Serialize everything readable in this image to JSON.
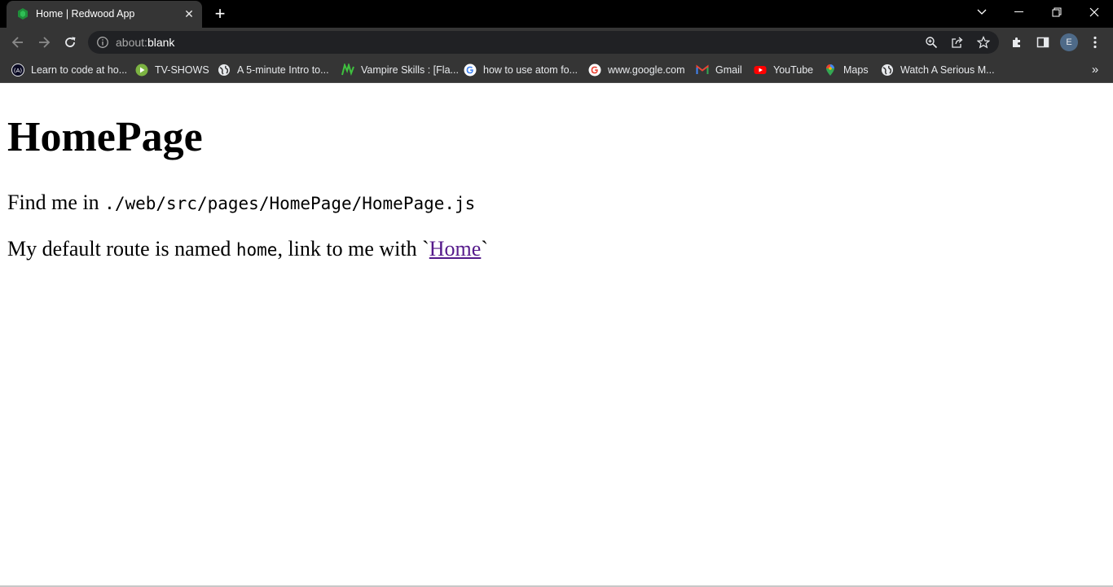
{
  "browser": {
    "tab": {
      "title": "Home | Redwood App",
      "favicon": "redwood-logo"
    },
    "omnibox": {
      "scheme": "about:",
      "path": "blank"
    },
    "profile_initial": "E",
    "bookmarks": [
      {
        "label": "Learn to code at ho...",
        "icon": "freecodecamp-icon"
      },
      {
        "label": "TV-SHOWS",
        "icon": "play-circle-icon"
      },
      {
        "label": "A 5-minute Intro to...",
        "icon": "globe-icon"
      },
      {
        "label": "Vampire Skills : [Fla...",
        "icon": "vampire-icon"
      },
      {
        "label": "how to use atom fo...",
        "icon": "google-icon"
      },
      {
        "label": "www.google.com",
        "icon": "google-icon"
      },
      {
        "label": "Gmail",
        "icon": "gmail-icon"
      },
      {
        "label": "YouTube",
        "icon": "youtube-icon"
      },
      {
        "label": "Maps",
        "icon": "maps-icon"
      },
      {
        "label": "Watch A Serious M...",
        "icon": "globe-icon"
      }
    ]
  },
  "page": {
    "heading": "HomePage",
    "line1": {
      "prefix": "Find me in ",
      "code": "./web/src/pages/HomePage/HomePage.js"
    },
    "line2": {
      "prefix": "My default route is named ",
      "code": "home",
      "middle": ", link to me with `",
      "link": "Home",
      "suffix": "`"
    }
  },
  "colors": {
    "chrome_bg": "#353535",
    "titlebar_bg": "#000000",
    "omnibox_bg": "#202124",
    "visited_link": "#551a8b"
  }
}
